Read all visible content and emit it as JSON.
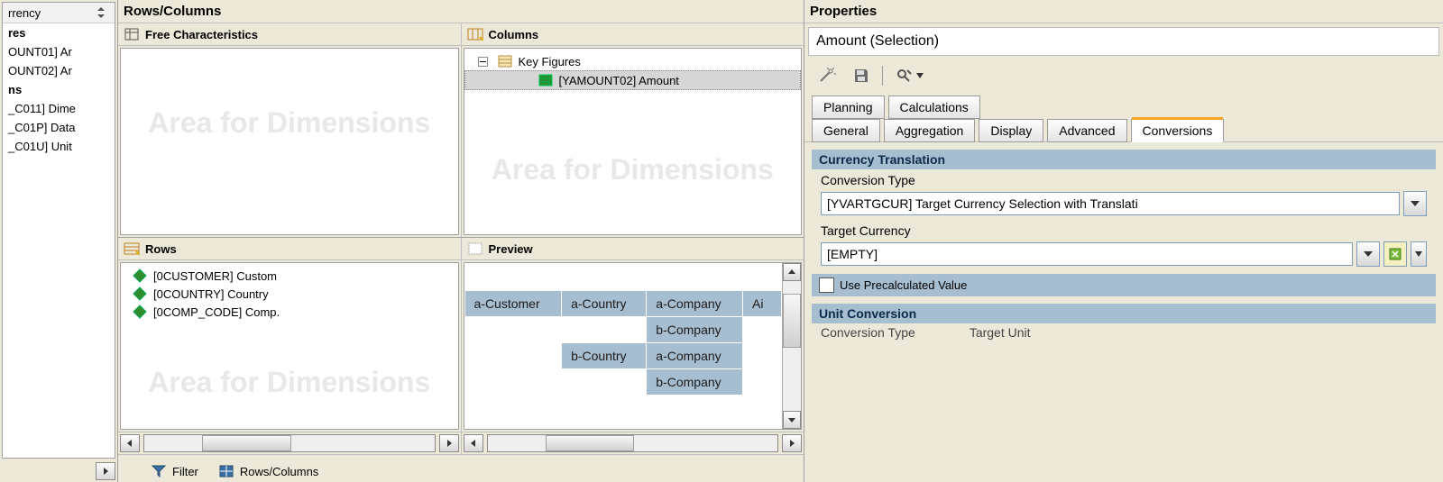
{
  "left": {
    "header": "rrency",
    "group1": "res",
    "items1": [
      "OUNT01] Ar",
      "OUNT02] Ar"
    ],
    "group2": "ns",
    "items2": [
      "_C011] Dime",
      "_C01P] Data",
      "_C01U] Unit"
    ]
  },
  "mid": {
    "title": "Rows/Columns",
    "freechar": "Free Characteristics",
    "columns": "Columns",
    "rows": "Rows",
    "preview": "Preview",
    "watermark": "Area for Dimensions",
    "col_tree": {
      "root": "Key Figures",
      "leaf": "[YAMOUNT02] Amount"
    },
    "row_items": [
      "[0CUSTOMER] Custom",
      "[0COUNTRY] Country",
      "[0COMP_CODE] Comp."
    ],
    "preview_table": {
      "rows": [
        [
          "a-Customer",
          "a-Country",
          "a-Company",
          "Ai"
        ],
        [
          "",
          "",
          "b-Company",
          ""
        ],
        [
          "",
          "b-Country",
          "a-Company",
          ""
        ],
        [
          "",
          "",
          "b-Company",
          ""
        ]
      ]
    },
    "tabs": {
      "filter": "Filter",
      "rc": "Rows/Columns"
    }
  },
  "right": {
    "title": "Properties",
    "subject": "Amount (Selection)",
    "tabs_row1": [
      "Planning",
      "Calculations"
    ],
    "tabs_row2": [
      "General",
      "Aggregation",
      "Display",
      "Advanced",
      "Conversions"
    ],
    "active_tab": "Conversions",
    "currency_group": "Currency Translation",
    "conv_type_label": "Conversion Type",
    "conv_type_value": "[YVARTGCUR] Target Currency Selection with Translati",
    "target_currency_label": "Target Currency",
    "target_currency_value": "[EMPTY]",
    "use_precalc": "Use Precalculated Value",
    "unit_group": "Unit Conversion",
    "unit_conv_type": "Conversion Type",
    "unit_target": "Target Unit"
  }
}
